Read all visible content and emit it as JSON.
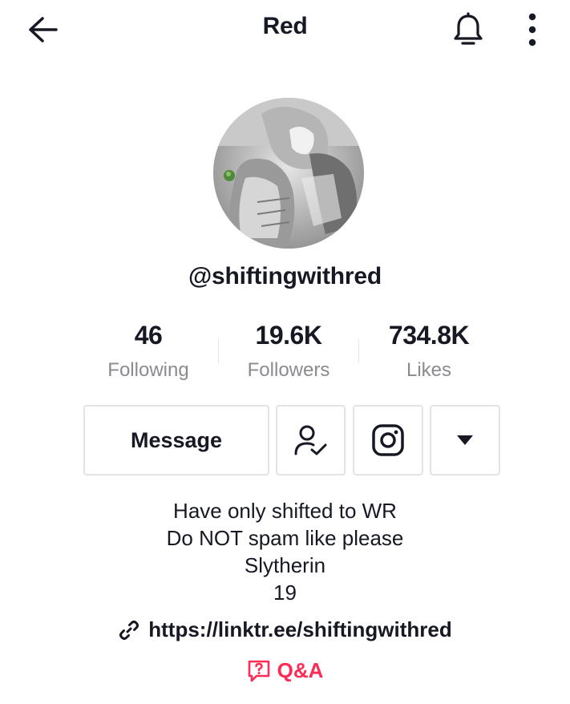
{
  "header": {
    "title": "Red",
    "back_icon": "arrow-left-icon",
    "bell_icon": "bell-icon",
    "more_icon": "more-vertical-icon"
  },
  "profile": {
    "username": "@shiftingwithred",
    "avatar_icon": "avatar-image"
  },
  "stats": [
    {
      "value": "46",
      "label": "Following"
    },
    {
      "value": "19.6K",
      "label": "Followers"
    },
    {
      "value": "734.8K",
      "label": "Likes"
    }
  ],
  "actions": {
    "message_label": "Message",
    "following_icon": "user-check-icon",
    "instagram_icon": "instagram-icon",
    "dropdown_icon": "caret-down-icon"
  },
  "bio": {
    "lines": [
      "Have only shifted to WR",
      "Do NOT spam like please",
      "Slytherin",
      "19"
    ],
    "link": "https://linktr.ee/shiftingwithred",
    "qa_label": "Q&A"
  },
  "colors": {
    "text": "#161823",
    "secondary": "#8a8b91",
    "border": "#e3e3e4",
    "accent": "#fe2c55"
  }
}
